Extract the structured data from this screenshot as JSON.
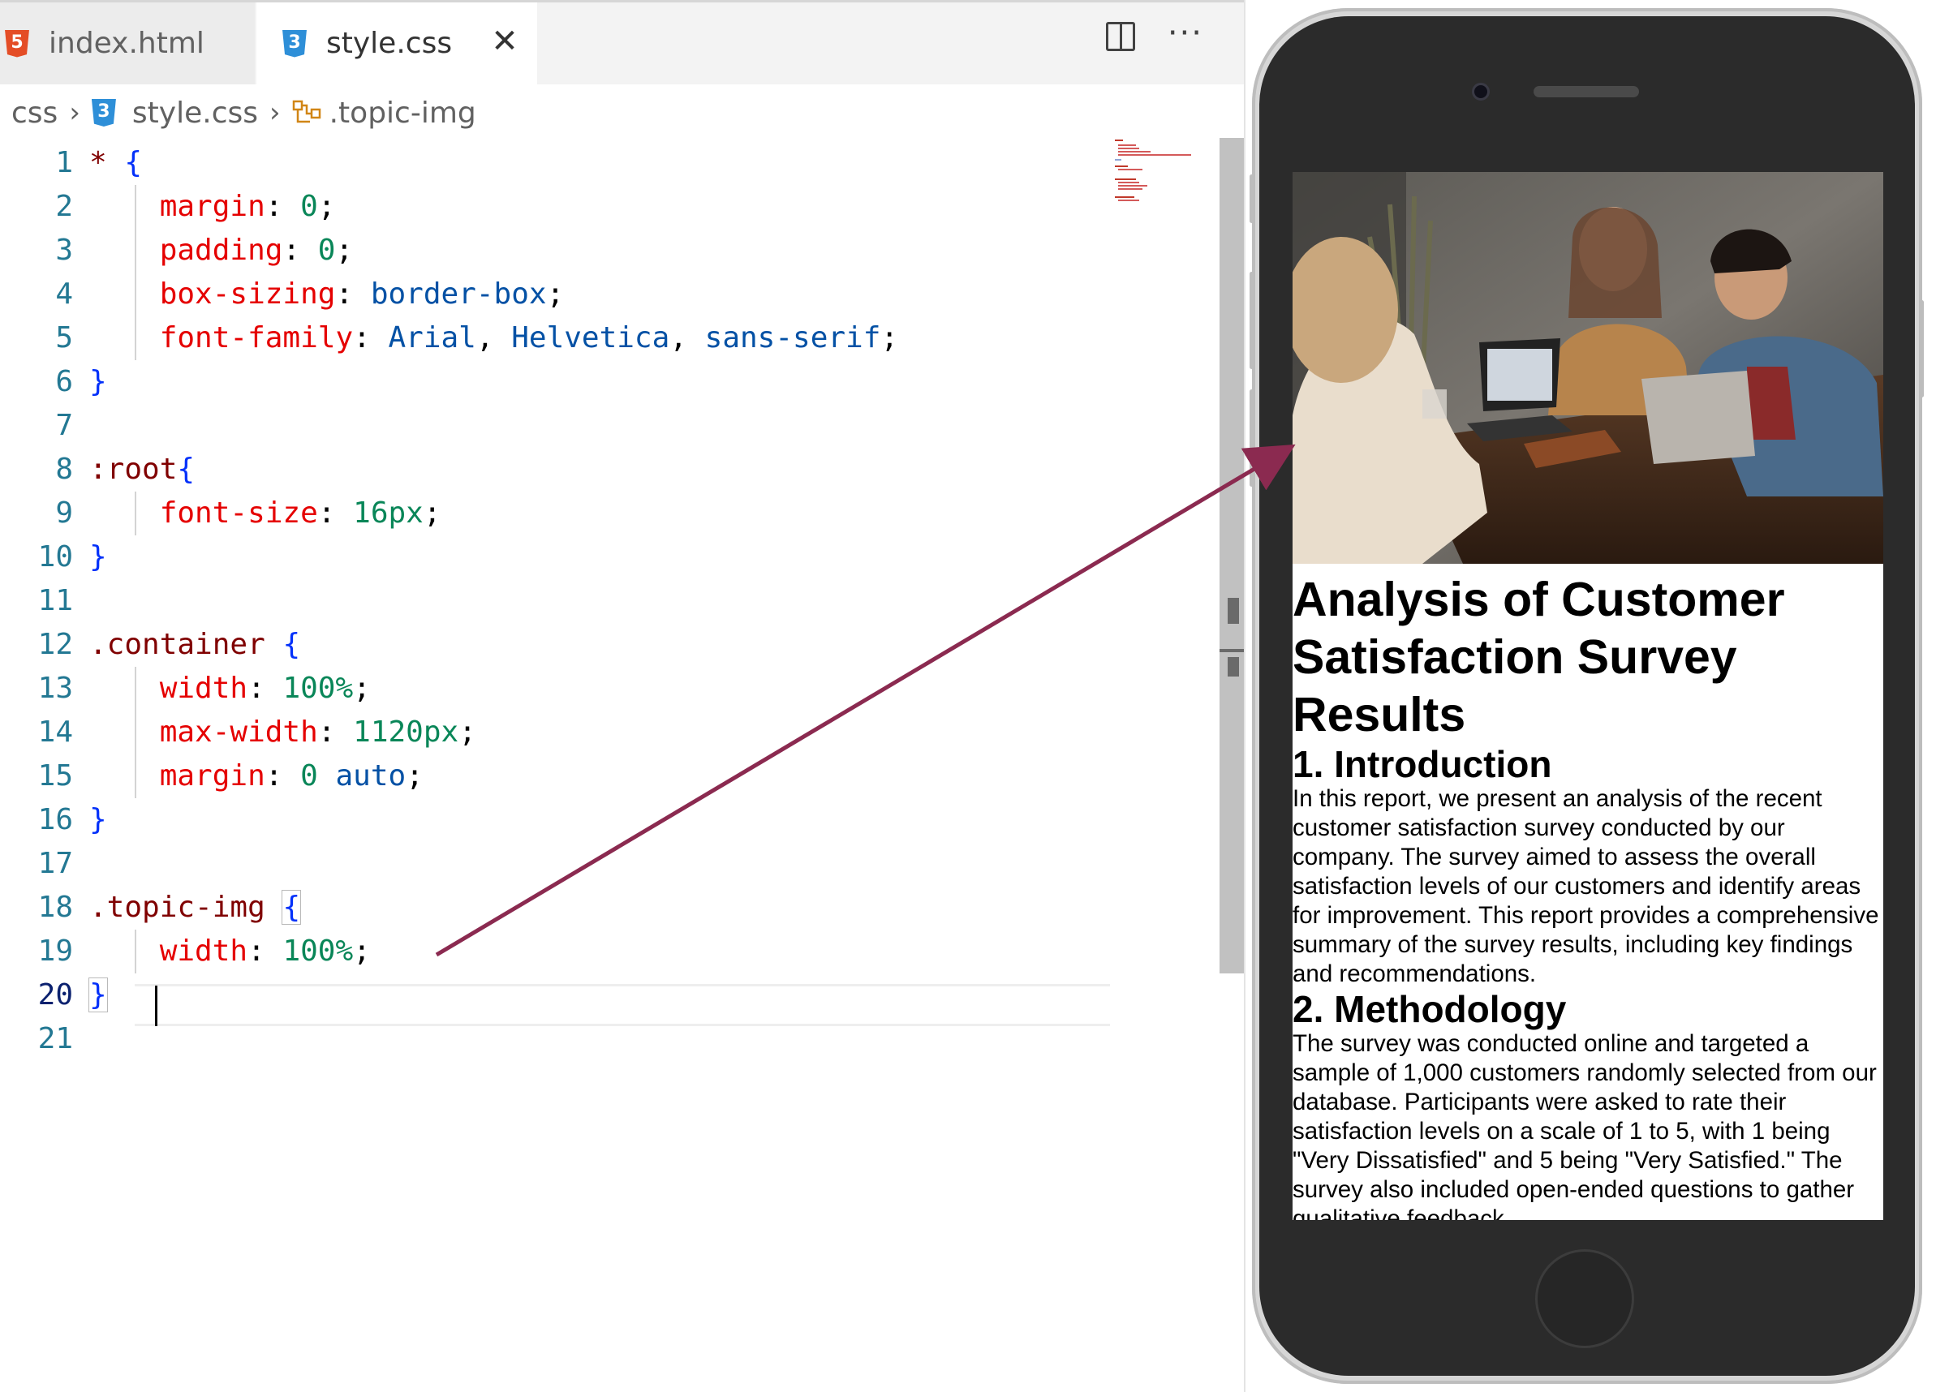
{
  "tabs": [
    {
      "label": "index.html",
      "icon": "html5-file-icon",
      "active": false
    },
    {
      "label": "style.css",
      "icon": "css3-file-icon",
      "active": true
    }
  ],
  "tab_actions": {
    "more": "···"
  },
  "breadcrumb": {
    "folder": "css",
    "file": "style.css",
    "symbol": ".topic-img"
  },
  "code_lines": [
    {
      "n": "1"
    },
    {
      "n": "2"
    },
    {
      "n": "3"
    },
    {
      "n": "4"
    },
    {
      "n": "5"
    },
    {
      "n": "6"
    },
    {
      "n": "7"
    },
    {
      "n": "8"
    },
    {
      "n": "9"
    },
    {
      "n": "10"
    },
    {
      "n": "11"
    },
    {
      "n": "12"
    },
    {
      "n": "13"
    },
    {
      "n": "14"
    },
    {
      "n": "15"
    },
    {
      "n": "16"
    },
    {
      "n": "17"
    },
    {
      "n": "18"
    },
    {
      "n": "19"
    },
    {
      "n": "20"
    },
    {
      "n": "21"
    }
  ],
  "code": {
    "l1_sel": "*",
    "l1_brace": "{",
    "l2_prop": "margin",
    "l2_val": "0",
    "l3_prop": "padding",
    "l3_val": "0",
    "l4_prop": "box-sizing",
    "l4_val": "border-box",
    "l5_prop": "font-family",
    "l5_v1": "Arial",
    "l5_v2": "Helvetica",
    "l5_v3": "sans-serif",
    "l6_brace": "}",
    "l8_sel": ":root",
    "l8_brace": "{",
    "l9_prop": "font-size",
    "l9_val": "16px",
    "l10_brace": "}",
    "l12_sel": ".container",
    "l12_brace": "{",
    "l13_prop": "width",
    "l13_val": "100%",
    "l14_prop": "max-width",
    "l14_val": "1120px",
    "l15_prop": "margin",
    "l15_v1": "0",
    "l15_v2": "auto",
    "l16_brace": "}",
    "l18_sel": ".topic-img",
    "l18_brace": "{",
    "l19_prop": "width",
    "l19_val": "100%",
    "l20_brace": "}"
  },
  "active_line": 20,
  "preview": {
    "image_alt": "Three people working at laptops around a cafe table",
    "title": "Analysis of Customer Satisfaction Survey Results",
    "sections": [
      {
        "heading": "1. Introduction",
        "text": "In this report, we present an analysis of the recent customer satisfaction survey conducted by our company. The survey aimed to assess the overall satisfaction levels of our customers and identify areas for improvement. This report provides a comprehensive summary of the survey results, including key findings and recommendations."
      },
      {
        "heading": "2. Methodology",
        "text": "The survey was conducted online and targeted a sample of 1,000 customers randomly selected from our database. Participants were asked to rate their satisfaction levels on a scale of 1 to 5, with 1 being \"Very Dissatisfied\" and 5 being \"Very Satisfied.\" The survey also included open-ended questions to gather qualitative feedback."
      }
    ]
  },
  "colors": {
    "selector": "#800000",
    "property": "#e50000",
    "number": "#098658",
    "value": "#0451a5",
    "brace": "#0431fa",
    "line_number": "#237893",
    "annotation_arrow": "#8b2a50",
    "phone_body": "#2b2b2b"
  }
}
